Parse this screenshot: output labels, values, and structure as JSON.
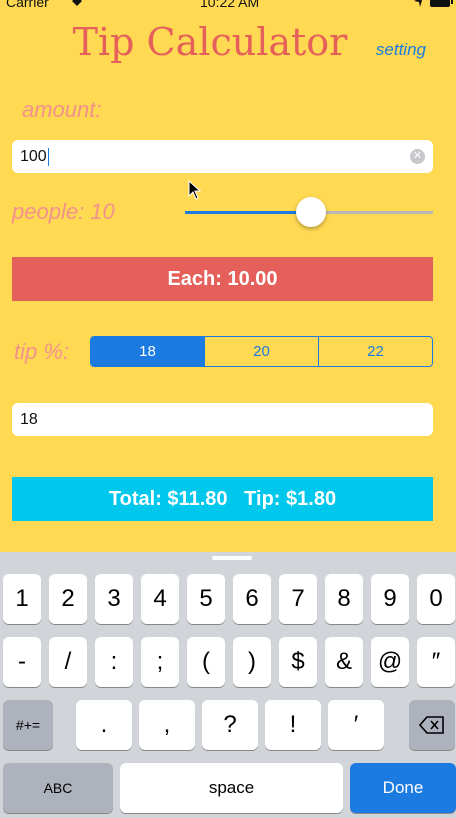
{
  "status_bar": {
    "carrier": "Carrier",
    "time": "10:22 AM"
  },
  "header": {
    "title": "Tip Calculator",
    "setting_label": "setting"
  },
  "amount": {
    "label": "amount:",
    "value": "100"
  },
  "people": {
    "label": "people: 10",
    "slider_value": 0.5
  },
  "each": {
    "text": "Each: 10.00"
  },
  "tip": {
    "label": "tip %:",
    "options": [
      "18",
      "20",
      "22"
    ],
    "selected_index": 0,
    "value": "18"
  },
  "total": {
    "text": "Total: $11.80   Tip: $1.80"
  },
  "colors": {
    "background": "#FFD952",
    "accent": "#1B7BE0",
    "each_bar": "#E5605A",
    "total_bar": "#00C7EC"
  },
  "keyboard": {
    "row1": [
      "1",
      "2",
      "3",
      "4",
      "5",
      "6",
      "7",
      "8",
      "9",
      "0"
    ],
    "row2": [
      "-",
      "/",
      ":",
      ";",
      "(",
      ")",
      "$",
      "&",
      "@",
      "″"
    ],
    "row3_left": "#+=",
    "row3": [
      ".",
      ",",
      "?",
      "!",
      "′"
    ],
    "delete_icon": "backspace-icon",
    "abc": "ABC",
    "space": "space",
    "done": "Done"
  }
}
